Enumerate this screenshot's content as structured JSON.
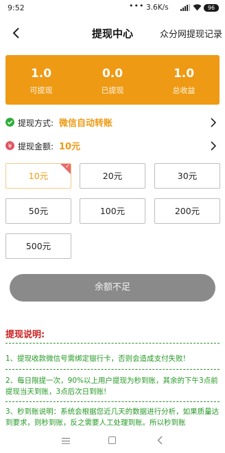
{
  "status_bar": {
    "time": "9:52",
    "dots": "•••",
    "network": "3.6K/s",
    "battery": "96"
  },
  "header": {
    "title": "提现中心",
    "right_link": "众分网提现记录"
  },
  "stats": [
    {
      "value": "1.0",
      "label": "可提现"
    },
    {
      "value": "0.0",
      "label": "已提现"
    },
    {
      "value": "1.0",
      "label": "总收益"
    }
  ],
  "method": {
    "label": "提现方式:",
    "value": "微信自动转账"
  },
  "amount": {
    "label": "提现金额:",
    "value": "10元"
  },
  "amount_options": [
    "10元",
    "20元",
    "30元",
    "50元",
    "100元",
    "200元",
    "500元"
  ],
  "submit": {
    "label": "余额不足"
  },
  "notes": {
    "title": "提现说明:",
    "items": [
      "1、提现收款微信号需绑定银行卡，否则会造成支付失败!",
      "2、每日限提一次，90%以上用户提现为秒到账，其余的下午3点前提现当天到账，3点后次日到账!",
      "3、秒到账说明：系统会根据您近几天的数据进行分析，如果质量达到要求，则秒到账，反之需要人工处理到账。所以秒到账"
    ]
  },
  "colors": {
    "accent": "#ee9a14",
    "note_green": "#239823",
    "note_title_red": "#cc1f1f",
    "disabled_button": "#8a8a8a"
  }
}
